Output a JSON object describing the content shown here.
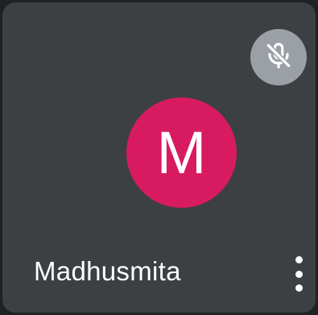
{
  "participant": {
    "name": "Madhusmita",
    "avatar_initial": "M",
    "avatar_color": "#d81b60",
    "mic_state": "muted"
  },
  "icons": {
    "mic": "mic-off-icon",
    "more": "more-vertical-icon"
  },
  "colors": {
    "tile_background": "#3c4043",
    "page_background": "#202124",
    "mic_button_background": "#9aa0a6"
  }
}
